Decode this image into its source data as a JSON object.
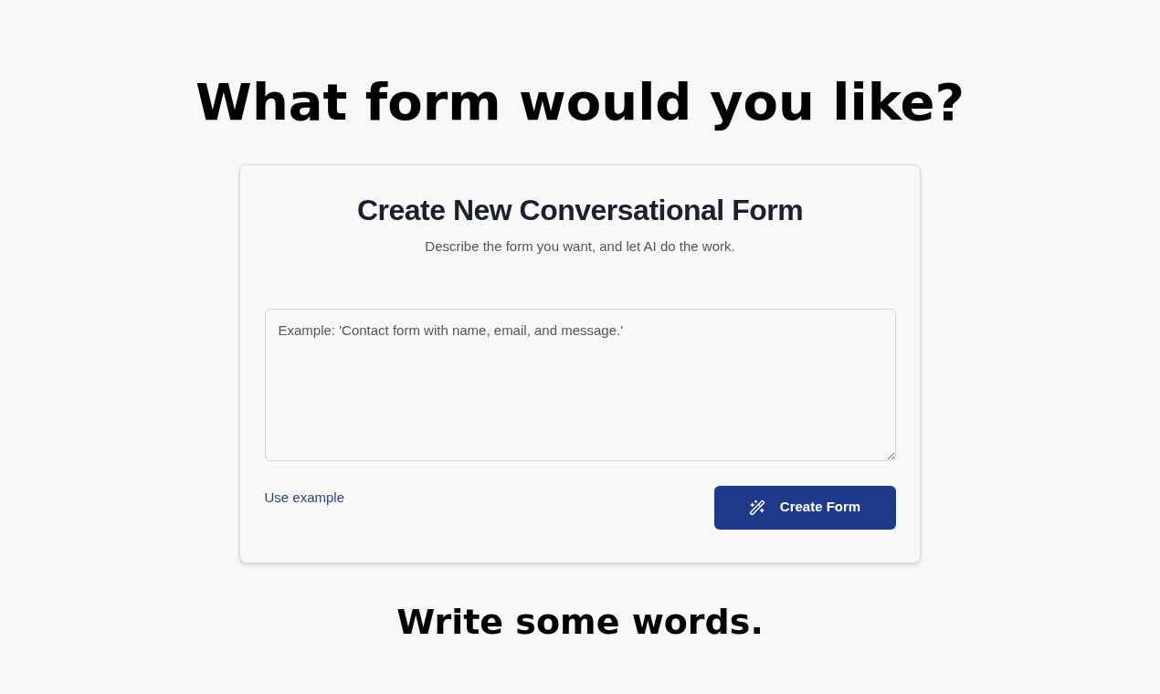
{
  "heading": "What form would you like?",
  "card": {
    "title": "Create New Conversational Form",
    "subtitle": "Describe the form you want, and let AI do the work.",
    "prompt_field": {
      "placeholder": "Example: 'Contact form with name, email, and message.'"
    },
    "example_link": "Use example",
    "create_button": "Create Form"
  },
  "footer": "Write some words."
}
